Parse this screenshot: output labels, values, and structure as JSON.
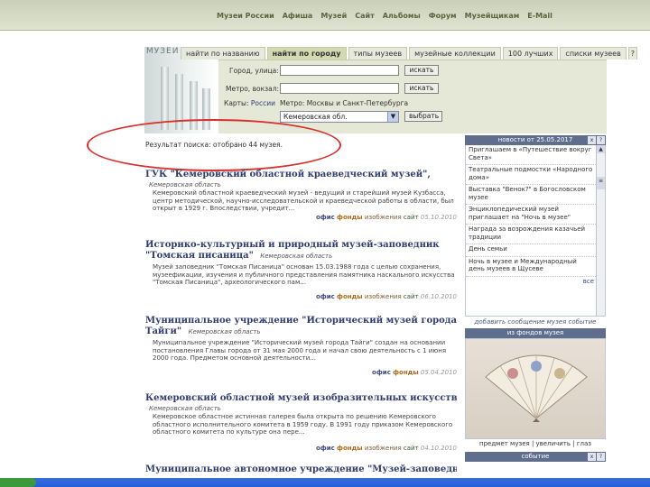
{
  "top_nav": [
    "Музеи России",
    "Афиша",
    "Музей",
    "Сайт",
    "Альбомы",
    "Форум",
    "Музейщикам",
    "E-Mail"
  ],
  "logo_text": "МУЗЕИ",
  "tabs": [
    {
      "label": "найти по названию",
      "active": false
    },
    {
      "label": "найти по городу",
      "active": true
    },
    {
      "label": "типы музеев",
      "active": false
    },
    {
      "label": "музейные коллекции",
      "active": false
    },
    {
      "label": "100 лучших",
      "active": false
    },
    {
      "label": "списки музеев",
      "active": false
    },
    {
      "label": "?",
      "active": false
    }
  ],
  "search": {
    "city_label": "Город, улица:",
    "metro_label": "Метро, вокзал:",
    "find_button": "искать",
    "maps_label": "Карты:",
    "map_russia": "России",
    "metro_links": "Метро: Москвы и Санкт-Петербурга",
    "region_selected": "Кемеровская обл.",
    "select_button": "выбрать"
  },
  "result_text": "Результат поиска: отобрано 44 музея.",
  "links": {
    "office": "офис",
    "funds": "фонды",
    "images": "изобжения",
    "site": "сайт"
  },
  "entries": [
    {
      "title": "ГУК \"Кемеровский областной краеведческий музей\",",
      "region": "Кемеровская область",
      "desc": "Кемеровский областной краеведческий музей - ведущий и старейший музей Кузбасса, центр методической, научно-исследовательской и краеведческой работы в области, был открыт в 1929 г. Впоследствии, учредит...",
      "has_images": true,
      "has_site": true,
      "date": "05.10.2010"
    },
    {
      "title": "Историко-культурный и природный музей-заповедник",
      "title2": "\"Томская писаница\"",
      "region": "Кемеровская область",
      "desc": "Музей заповедник \"Томская Писаница\" основан 15.03.1988 года с целью сохранения, музеефикации, изучения и публичного представления памятника наскального искусства \"Томская Писаница\", археологического пам...",
      "has_images": true,
      "has_site": true,
      "date": "06.10.2010"
    },
    {
      "title": "Муниципальное учреждение \"Исторический музей города",
      "title2": "Тайги\"",
      "region": "Кемеровская область",
      "desc": "Муниципальное учреждение \"Исторический музей города Тайги\" создан на основании постановления Главы города от 31 мая 2000 года и начал свою деятельность с 1 июня 2000 года. Предметом основной деятельности...",
      "has_images": false,
      "has_site": false,
      "date": "05.04.2010"
    },
    {
      "title": "Кемеровский областной музей изобразительных искусств,",
      "region": "Кемеровская область",
      "desc": "Кемеровское областное истинная галерея была открыта по решению Кемеровского областного исполнительного комитета в 1959 году. В 1991 году приказом Кемеровского областного комитета по культуре она пере...",
      "has_images": true,
      "has_site": true,
      "date": "04.10.2010"
    },
    {
      "title": "Муниципальное автономное учреждение \"Музей-заповедник"
    }
  ],
  "sidebar": {
    "news_title": "новости от 25.05.2017",
    "news": [
      "Приглашаем в «Путешествие вокруг Света»",
      "Театральные подмостки «Народного дома»",
      "Выставка \"Венок?\" в Богословском музее",
      "Энциклопедический музей приглашает на \"Ночь в музее\"",
      "Награда за возрождения казачьей традиции",
      "День семьи",
      "Ночь в музее и Международный день музеев в Щусеве"
    ],
    "news_more": "все",
    "add_message": "добавить сообщение музея событие",
    "funds_title": "из фондов музея",
    "funds_caption": "предмет музея | увеличить | глаз",
    "event_title": "событие",
    "btn_x": "x",
    "btn_q": "?"
  },
  "colors": {
    "nav_bar": "#c9d0b7",
    "search_panel": "#e5e8d6",
    "title_blue": "#2f3d6e",
    "annotation_red": "#d63030",
    "sidebar_header": "#5f6e8c"
  }
}
